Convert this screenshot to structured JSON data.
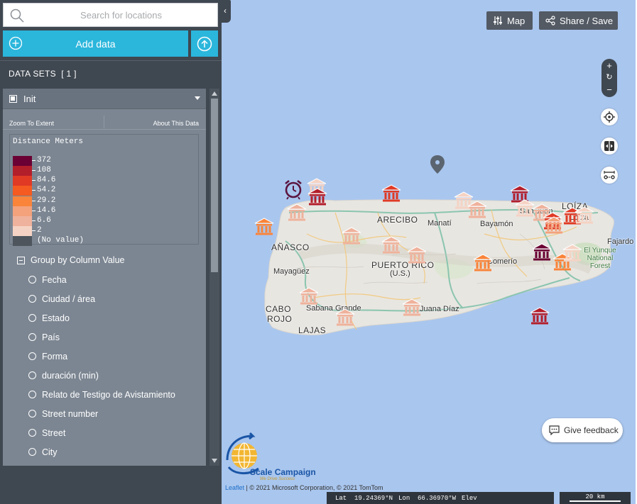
{
  "search": {
    "placeholder": "Search for locations",
    "icon": "search-icon"
  },
  "sidebar": {
    "add_data_label": "Add data",
    "upload_icon": "upload-icon",
    "collapse_icon": "chevron-left-icon",
    "datasets_header": "DATA SETS  [ 1 ]",
    "dataset": {
      "title": "Init",
      "zoom_to_extent": "Zoom To Extent",
      "about_data": "About This Data"
    },
    "legend": {
      "title": "Distance Meters",
      "items": [
        {
          "label": "372",
          "color": "#6a0033"
        },
        {
          "label": "108",
          "color": "#b31e2b"
        },
        {
          "label": "84.6",
          "color": "#e03a25"
        },
        {
          "label": "54.2",
          "color": "#f55a20"
        },
        {
          "label": "29.2",
          "color": "#f9843a"
        },
        {
          "label": "14.6",
          "color": "#f3a27c"
        },
        {
          "label": "6.6",
          "color": "#efb29c"
        },
        {
          "label": "2",
          "color": "#f5d3c4"
        },
        {
          "label": "(No value)",
          "color": "#4e555d"
        }
      ]
    },
    "group_by": {
      "label": "Group by Column Value",
      "options": [
        "Fecha",
        "Ciudad / área",
        "Estado",
        "País",
        "Forma",
        "duración (min)",
        "Relato de Testigo de Avistamiento",
        "Street number",
        "Street",
        "City"
      ]
    }
  },
  "map": {
    "map_button": "Map",
    "share_button": "Share / Save",
    "zoom_in": "+",
    "zoom_reset": "↻",
    "zoom_out": "−",
    "feedback_label": "Give feedback",
    "labels": {
      "loiza": "LOÍZA",
      "san_juan": "San Juan",
      "loiza_small": "Loíza",
      "fajardo": "Fajardo",
      "yunque": "El Yunque National Forest",
      "arecibo": "ARECIBO",
      "manati": "Manatí",
      "bayamon": "Bayamón",
      "anasco": "AÑASCO",
      "mayaguez": "Mayagüez",
      "puerto_rico": "PUERTO RICO",
      "us": "(U.S.)",
      "comerio": "Comerío",
      "cabo_rojo_1": "CABO",
      "cabo_rojo_2": "ROJO",
      "sabana_grande": "Sabana Grande",
      "juana_diaz": "Juana Díaz",
      "lajas": "LAJAS"
    },
    "logo": {
      "brand": "Scale Campaign",
      "tagline": "We Drive Success"
    },
    "attribution": {
      "leaflet": "Leaflet",
      "rest": " | © 2021 Microsoft Corporation, © 2021 TomTom"
    },
    "coords": {
      "lat": "Lat  19.24369°N",
      "lon": "Lon  66.36970°W",
      "elev": "Elev"
    },
    "scale": "20 km",
    "colors": {
      "water": "#a9c6ee",
      "land": "#e8e6e1",
      "accent": "#2bb6dc",
      "panel": "#3f4750"
    }
  }
}
